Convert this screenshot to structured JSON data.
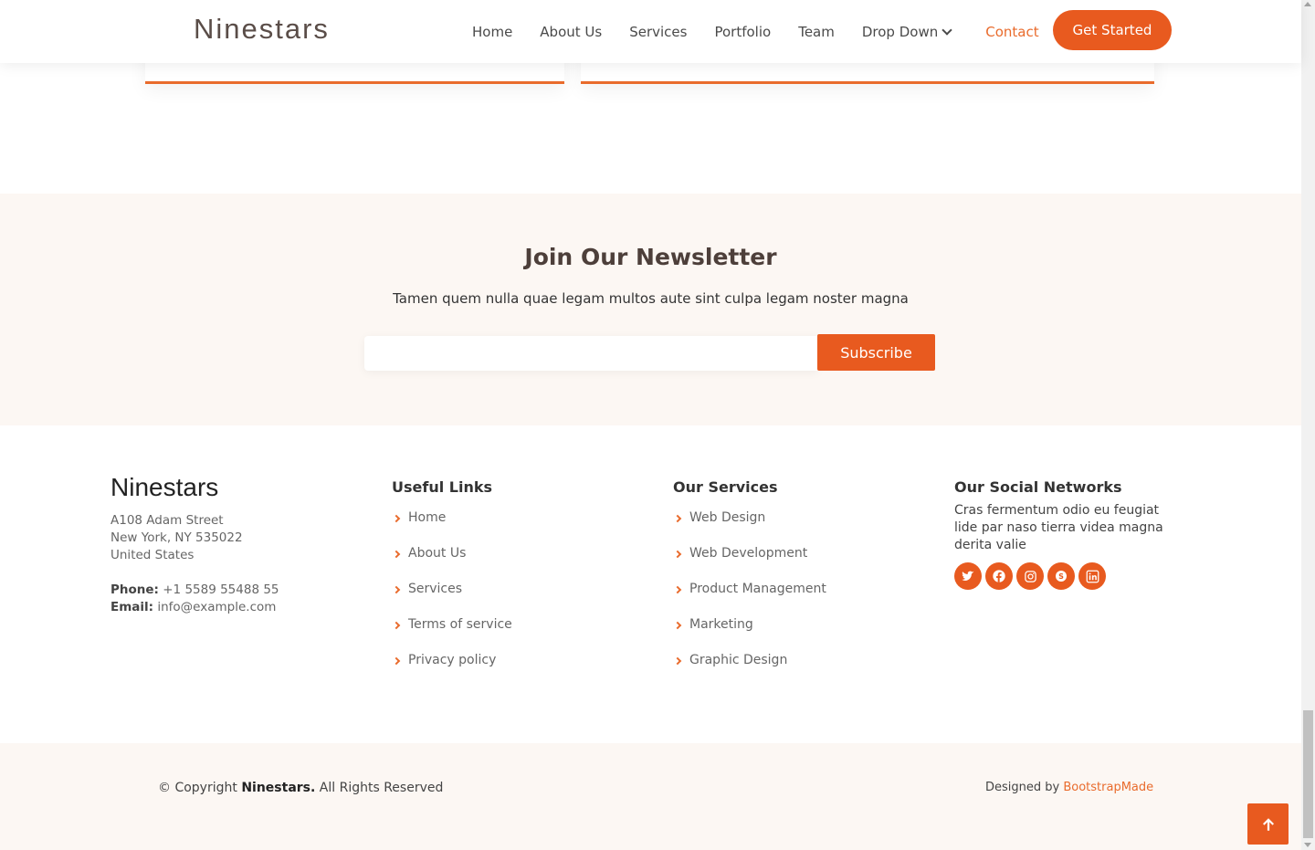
{
  "header": {
    "logo": "Ninestars",
    "nav": [
      {
        "label": "Home"
      },
      {
        "label": "About Us"
      },
      {
        "label": "Services"
      },
      {
        "label": "Portfolio"
      },
      {
        "label": "Team"
      },
      {
        "label": "Drop Down"
      },
      {
        "label": "Contact"
      }
    ],
    "cta_label": "Get Started"
  },
  "newsletter": {
    "title": "Join Our Newsletter",
    "subtitle": "Tamen quem nulla quae legam multos aute sint culpa legam noster magna",
    "input_value": "",
    "button_label": "Subscribe"
  },
  "footer": {
    "brand": "Ninestars",
    "address": [
      "A108 Adam Street",
      "New York, NY 535022",
      "United States"
    ],
    "phone_label": "Phone:",
    "phone": "+1 5589 55488 55",
    "email_label": "Email:",
    "email": "info@example.com",
    "useful_links": {
      "title": "Useful Links",
      "items": [
        "Home",
        "About Us",
        "Services",
        "Terms of service",
        "Privacy policy"
      ]
    },
    "services": {
      "title": "Our Services",
      "items": [
        "Web Design",
        "Web Development",
        "Product Management",
        "Marketing",
        "Graphic Design"
      ]
    },
    "social": {
      "title": "Our Social Networks",
      "text": "Cras fermentum odio eu feugiat lide par naso tierra videa magna derita valie",
      "icons": [
        "twitter-icon",
        "facebook-icon",
        "instagram-icon",
        "skype-icon",
        "linkedin-icon"
      ]
    }
  },
  "bottom": {
    "copy_prefix": "© Copyright ",
    "copy_brand": "Ninestars.",
    "copy_suffix": " All Rights Reserved",
    "designed_by": "Designed by ",
    "designer": "BootstrapMade"
  },
  "colors": {
    "accent": "#e85a1f",
    "link": "#e96b2c",
    "section_bg": "#fcf7f3"
  }
}
